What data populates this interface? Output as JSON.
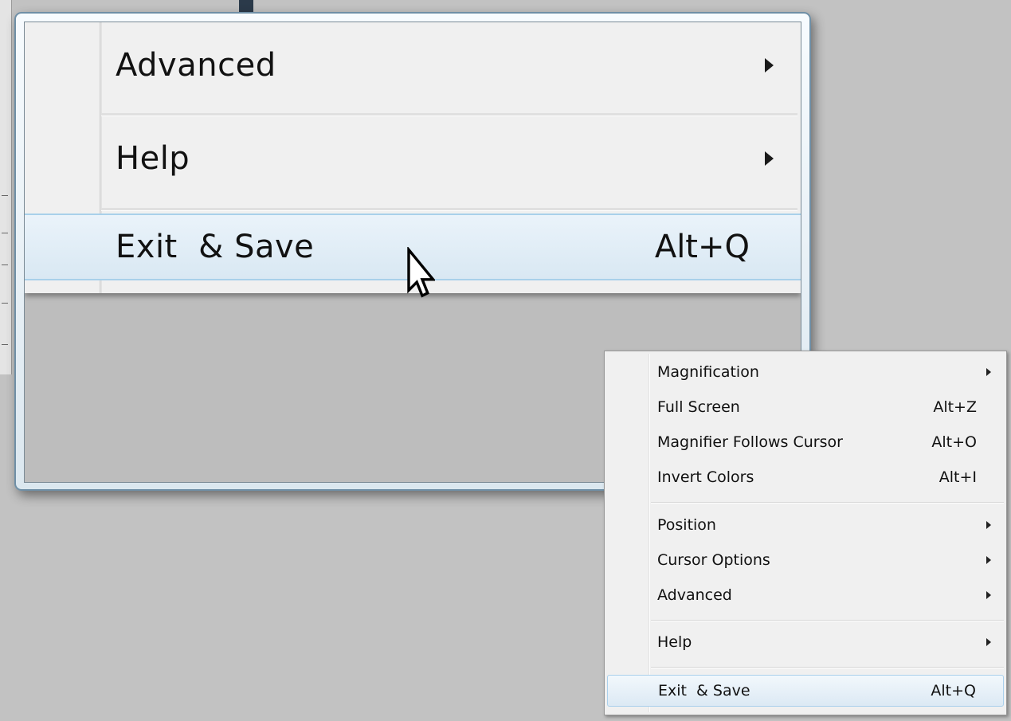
{
  "zoomed_menu": {
    "items": [
      {
        "label": "Advanced",
        "has_submenu": true
      },
      {
        "label": "Help",
        "has_submenu": true
      },
      {
        "label": "Exit  & Save",
        "shortcut": "Alt+Q",
        "highlighted": true
      }
    ]
  },
  "context_menu": {
    "items": [
      {
        "label": "Magnification",
        "has_submenu": true
      },
      {
        "label": "Full Screen",
        "shortcut": "Alt+Z"
      },
      {
        "label": "Magnifier Follows Cursor",
        "shortcut": "Alt+O"
      },
      {
        "label": "Invert Colors",
        "shortcut": "Alt+I"
      },
      {
        "label": "Position",
        "has_submenu": true
      },
      {
        "label": "Cursor Options",
        "has_submenu": true
      },
      {
        "label": "Advanced",
        "has_submenu": true
      },
      {
        "label": "Help",
        "has_submenu": true
      },
      {
        "label": "Exit  & Save",
        "shortcut": "Alt+Q",
        "highlighted": true
      }
    ]
  },
  "colors": {
    "desktop": "#c2c2c2",
    "menu_background": "#f0f0f0",
    "highlight_border": "#aad0ec"
  },
  "icons": {
    "submenu_arrow": "chevron-right-icon",
    "pointer": "mouse-pointer-icon"
  }
}
